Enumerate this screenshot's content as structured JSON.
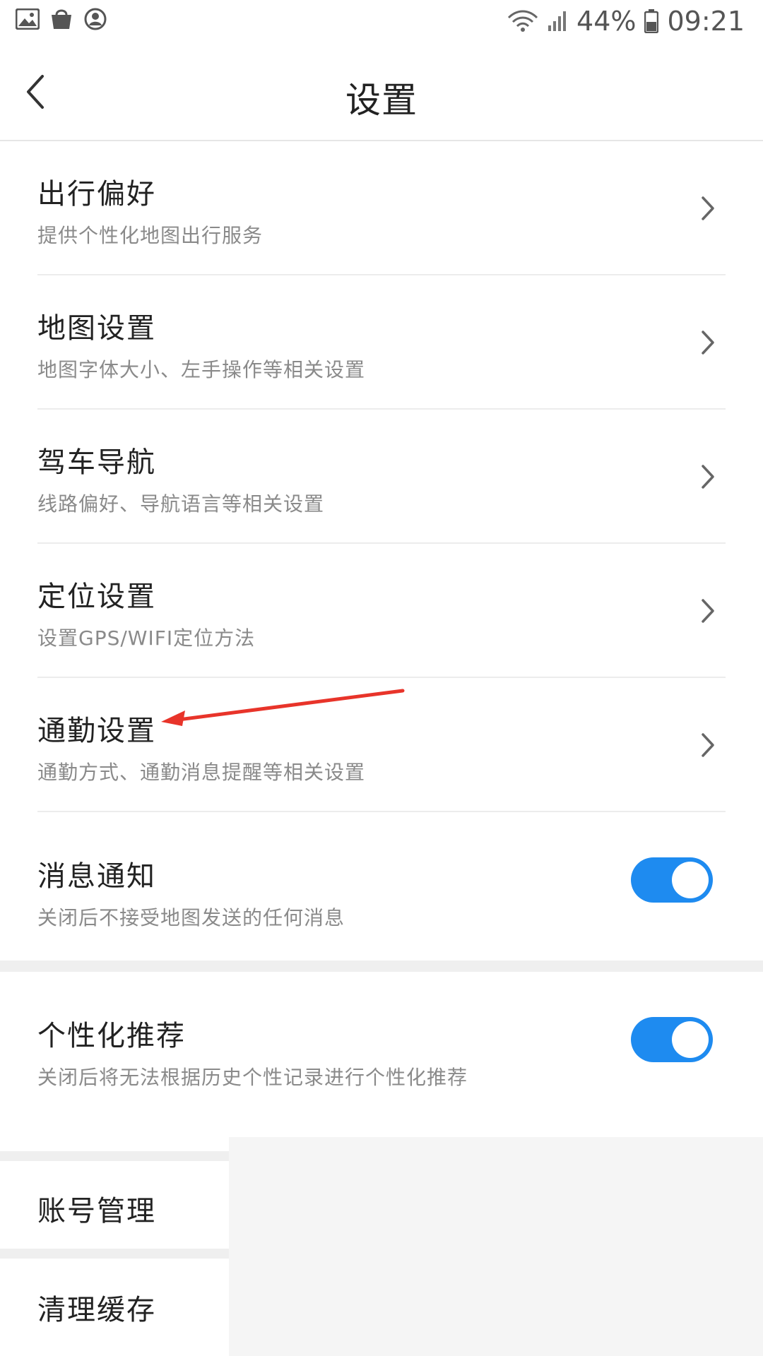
{
  "status_bar": {
    "left_icons": [
      "gallery-icon",
      "shopping-bag-icon",
      "account-icon"
    ],
    "right_icons": [
      "wifi-icon",
      "signal-icon",
      "battery-icon"
    ],
    "battery_percent": "44%",
    "time": "09:21"
  },
  "header": {
    "title": "设置",
    "back_icon": "chevron-left-icon"
  },
  "items": [
    {
      "title": "出行偏好",
      "subtitle": "提供个性化地图出行服务"
    },
    {
      "title": "地图设置",
      "subtitle": "地图字体大小、左手操作等相关设置"
    },
    {
      "title": "驾车导航",
      "subtitle": "线路偏好、导航语言等相关设置"
    },
    {
      "title": "定位设置",
      "subtitle": "设置GPS/WIFI定位方法"
    },
    {
      "title": "通勤设置",
      "subtitle": "通勤方式、通勤消息提醒等相关设置"
    }
  ],
  "toggles": [
    {
      "title": "消息通知",
      "subtitle": "关闭后不接受地图发送的任何消息",
      "on": true
    },
    {
      "title": "个性化推荐",
      "subtitle": "关闭后将无法根据历史个性记录进行个性化推荐",
      "on": true
    }
  ],
  "plain_items": [
    {
      "title": "账号管理"
    },
    {
      "title": "清理缓存"
    }
  ],
  "colors": {
    "toggle_on": "#1e8bf0",
    "annotation_arrow": "#e8342a"
  }
}
